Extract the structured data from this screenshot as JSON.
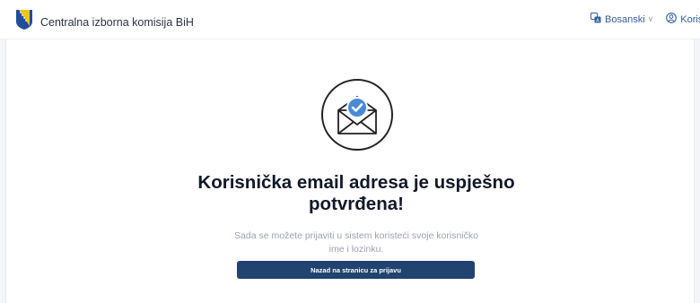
{
  "header": {
    "title": "Centralna izborna komisija BiH",
    "language": "Bosanski",
    "user": "Korisnik"
  },
  "main": {
    "heading": "Korisnička email adresa je uspješno potvrđena!",
    "description": "Sada se možete prijaviti u sistem koristeći svoje korisničko ime i lozinku.",
    "back_button": "Nazad na stranicu za prijavu"
  },
  "colors": {
    "primary": "#20436f",
    "accent": "#4a8ad4",
    "link": "#2f5f9e"
  },
  "icons": {
    "logo": "bih-coat-of-arms-icon",
    "language": "translate-icon",
    "user": "user-circle-icon",
    "illustration": "envelope-check-icon"
  }
}
